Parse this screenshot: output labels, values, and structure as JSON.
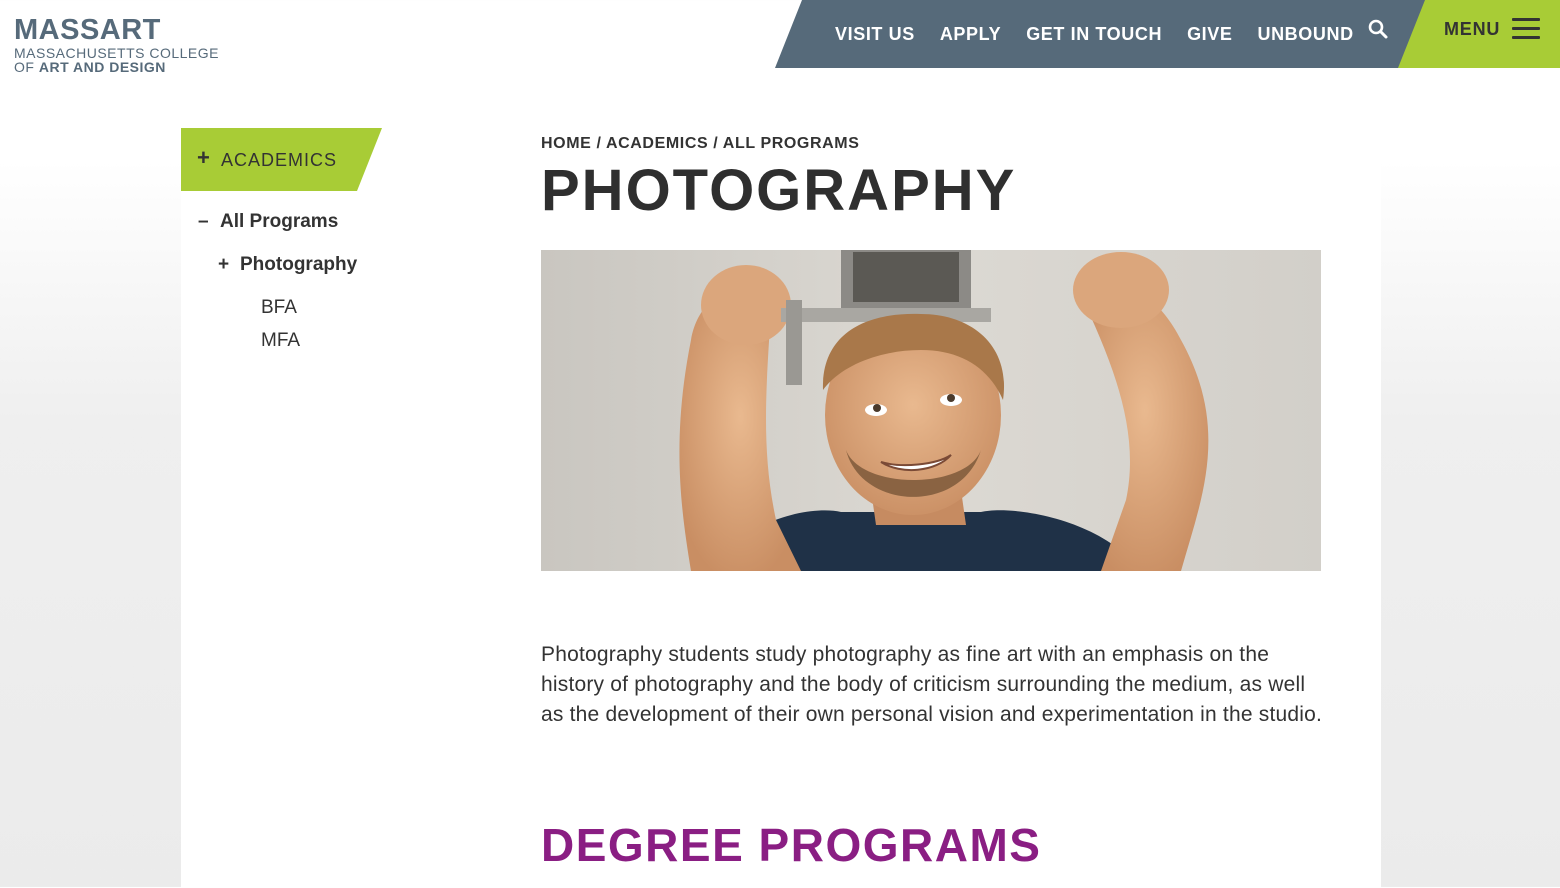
{
  "brand": {
    "wordmark": "MASSART",
    "subline1": "MASSACHUSETTS COLLEGE",
    "subline2_prefix": "OF",
    "subline2_bold": "ART AND DESIGN"
  },
  "topnav": {
    "links": [
      "VISIT US",
      "APPLY",
      "GET IN TOUCH",
      "GIVE",
      "UNBOUND"
    ],
    "menu_label": "MENU",
    "icons": [
      "search-icon",
      "hamburger-icon"
    ]
  },
  "sidebar": {
    "section_label": "ACADEMICS",
    "section_symbol": "+",
    "items": [
      {
        "symbol": "–",
        "label": "All Programs"
      },
      {
        "symbol": "+",
        "label": "Photography"
      },
      {
        "symbol": "",
        "label": "BFA"
      },
      {
        "symbol": "",
        "label": "MFA"
      }
    ]
  },
  "breadcrumb": {
    "items": [
      "HOME",
      "ACADEMICS",
      "ALL PROGRAMS"
    ],
    "separator": " / "
  },
  "main": {
    "title": "PHOTOGRAPHY",
    "intro": "Photography students study photography as fine art with an emphasis on the history of photography and the body of criticism surrounding the medium, as well as the development of their own personal vision and experimentation in the studio.",
    "section_heading": "DEGREE PROGRAMS"
  },
  "colors": {
    "nav_bg": "#566a7a",
    "accent_green": "#a8cc36",
    "heading_purple": "#8a1e83"
  }
}
